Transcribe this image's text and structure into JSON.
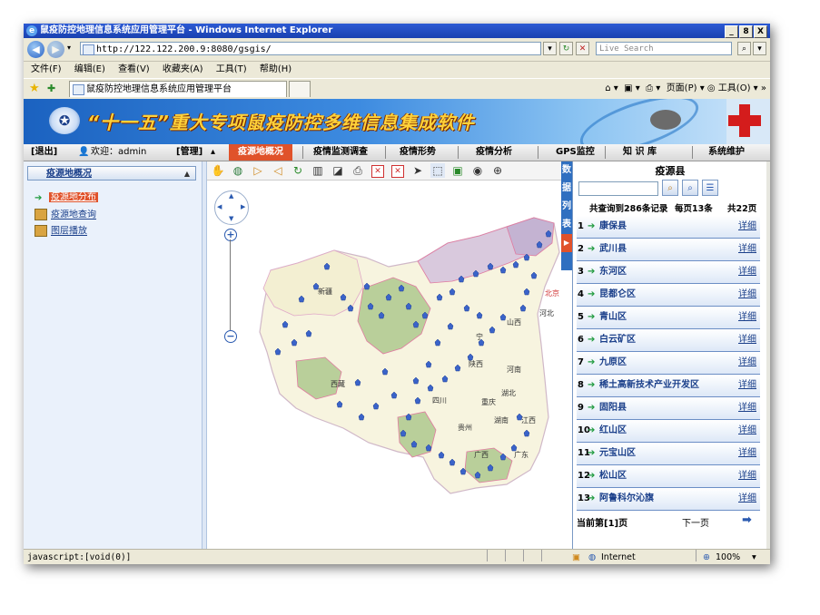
{
  "window": {
    "title": "鼠疫防控地理信息系统应用管理平台 - Windows Internet Explorer",
    "buttons": [
      "_",
      "8",
      "X"
    ]
  },
  "address_bar": {
    "url": "http://122.122.200.9:8080/gsgis/",
    "search_placeholder": "Live Search"
  },
  "menu": [
    "文件(F)",
    "编辑(E)",
    "查看(V)",
    "收藏夹(A)",
    "工具(T)",
    "帮助(H)"
  ],
  "tab": {
    "title": "鼠疫防控地理信息系统应用管理平台",
    "tools": "页面(P) ▾  ◎ 工具(O) ▾"
  },
  "banner": {
    "title": "“十一五”重大专项鼠疫防控多维信息集成软件"
  },
  "nav": {
    "logout": "[退出]",
    "welcome": "欢迎：admin",
    "manage": "[管理]",
    "items": [
      "疫源地概况",
      "疫情监测调查",
      "疫情形势",
      "疫情分析",
      "GPS监控",
      "知 识 库",
      "系统维护"
    ],
    "active_index": 0
  },
  "left_panel": {
    "header": "疫源地概况",
    "items": [
      {
        "label": "疫源地分布",
        "selected": true
      },
      {
        "label": "疫源地查询",
        "selected": false
      },
      {
        "label": "图层播放",
        "selected": false
      }
    ]
  },
  "map": {
    "labels": [
      "新疆",
      "西藏",
      "四川",
      "陕西",
      "河南",
      "湖北",
      "贵州",
      "湖南",
      "广西",
      "广东",
      "山西",
      "河北",
      "宁",
      "重庆",
      "江西",
      "北京"
    ]
  },
  "side_tab": {
    "chars": [
      "数",
      "据",
      "列",
      "表"
    ]
  },
  "right_panel": {
    "title": "疫源县",
    "stats": {
      "total": "共查询到286条记录",
      "per_page": "每页13条",
      "pages": "共22页"
    },
    "detail_label": "详细",
    "rows": [
      {
        "num": "1",
        "name": "康保县"
      },
      {
        "num": "2",
        "name": "武川县"
      },
      {
        "num": "3",
        "name": "东河区"
      },
      {
        "num": "4",
        "name": "昆都仑区"
      },
      {
        "num": "5",
        "name": "青山区"
      },
      {
        "num": "6",
        "name": "白云矿区"
      },
      {
        "num": "7",
        "name": "九原区"
      },
      {
        "num": "8",
        "name": "稀土高新技术产业开发区"
      },
      {
        "num": "9",
        "name": "固阳县"
      },
      {
        "num": "10",
        "name": "红山区"
      },
      {
        "num": "11",
        "name": "元宝山区"
      },
      {
        "num": "12",
        "name": "松山区"
      },
      {
        "num": "13",
        "name": "阿鲁科尔沁旗"
      }
    ],
    "footer": {
      "current": "当前第[1]页",
      "next": "下一页"
    }
  },
  "status_bar": {
    "left": "javascript:[void(0)]",
    "zone": "Internet",
    "zoom": "100%"
  },
  "colors": {
    "title_bar": "#1941b0",
    "nav_active": "#e0522a",
    "province_fill": "#b9cf9a",
    "map_base": "#f7f4df",
    "pin": "#3a63c9"
  }
}
